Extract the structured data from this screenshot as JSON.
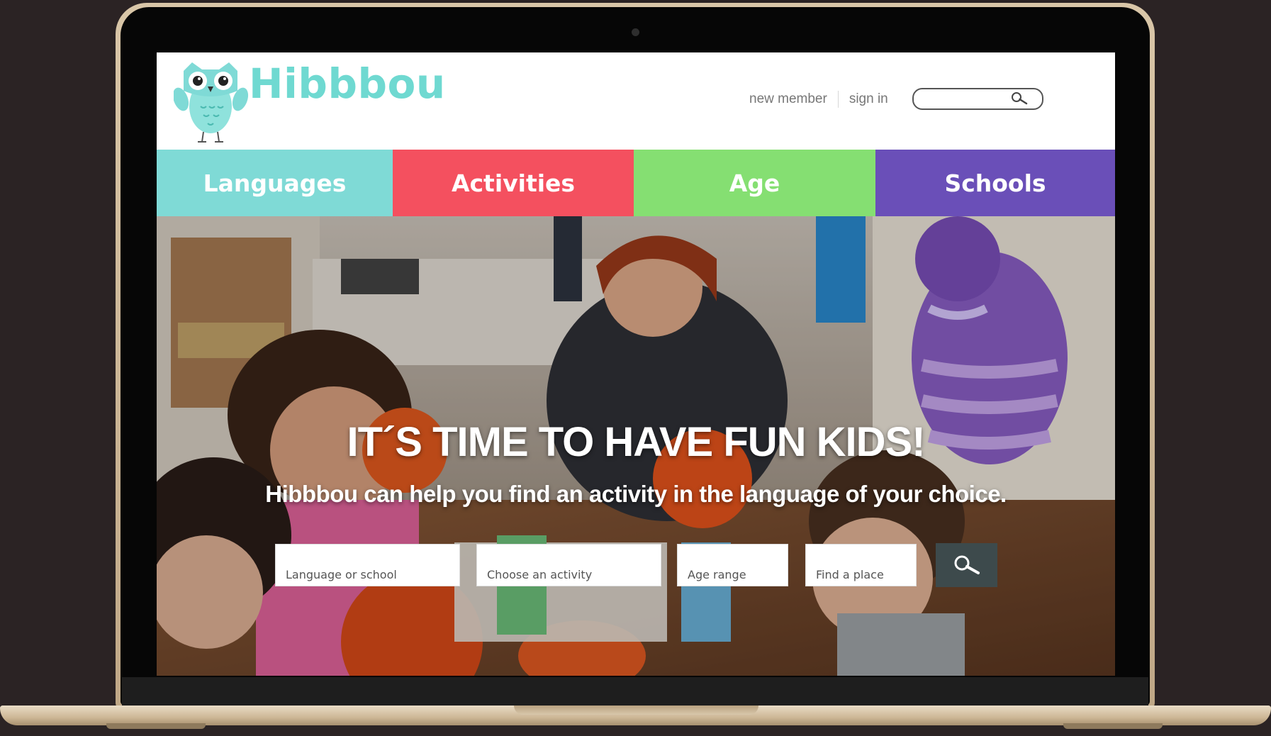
{
  "site": {
    "brand_name": "Hibbbou",
    "colors": {
      "brand": "#6fd9d1",
      "languages": "#7fdad6",
      "activities": "#f4505f",
      "age": "#85df72",
      "schools": "#6a4fb8",
      "search_button": "#3d4a4c"
    }
  },
  "header": {
    "new_member_label": "new member",
    "sign_in_label": "sign in",
    "search": {
      "value": "",
      "icon": "search-icon"
    }
  },
  "nav": {
    "tabs": [
      {
        "label": "Languages",
        "color": "#7fdad6"
      },
      {
        "label": "Activities",
        "color": "#f4505f"
      },
      {
        "label": "Age",
        "color": "#85df72"
      },
      {
        "label": "Schools",
        "color": "#6a4fb8"
      }
    ]
  },
  "hero": {
    "title": "IT´S TIME TO HAVE FUN KIDS!",
    "subtitle": "Hibbbou can help you find an activity in the language of your choice.",
    "fields": {
      "language": {
        "placeholder": "Language or school"
      },
      "activity": {
        "placeholder": "Choose an activity"
      },
      "age": {
        "placeholder": "Age range"
      },
      "place": {
        "placeholder": "Find a place"
      }
    },
    "search_button_icon": "search-icon"
  }
}
